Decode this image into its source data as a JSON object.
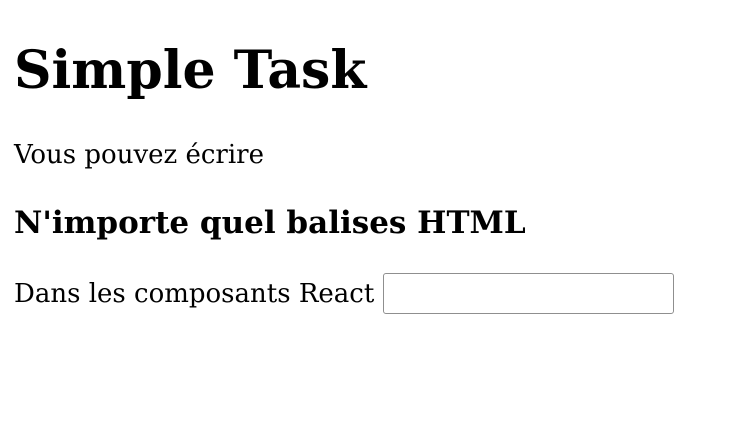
{
  "page": {
    "title": "Simple Task",
    "paragraph": "Vous pouvez écrire",
    "subtitle": "N'importe quel balises HTML",
    "input_row": {
      "label": "Dans les composants React",
      "value": "",
      "placeholder": ""
    }
  }
}
